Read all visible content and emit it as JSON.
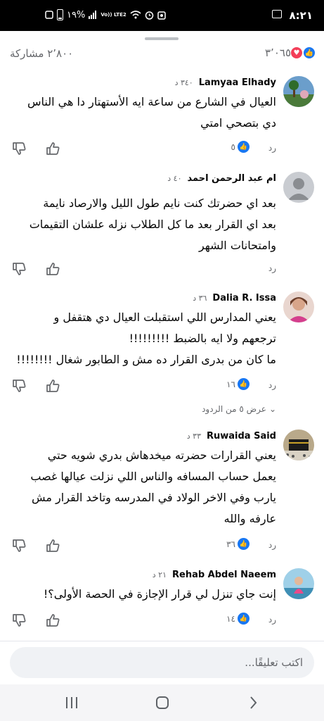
{
  "status_bar": {
    "time": "٨:٢١",
    "battery": "١٩%",
    "network": "Vo)) LTE2"
  },
  "summary": {
    "reaction_count": "٣٬٠٦٥",
    "shares": "٢٬٨٠٠ مشاركة",
    "reaction_types": [
      "like-icon",
      "love-icon"
    ]
  },
  "comments": [
    {
      "author": "Lamyaa Elhady",
      "age": "٣٤٠ د",
      "lines": [
        "العيال في الشارع من ساعة ايه الأستهتار دا هي الناس",
        "دي بتصحي امتي"
      ],
      "reply_label": "رد",
      "like_count": "٥"
    },
    {
      "author": "ام عبد الرحمن احمد",
      "age": "٤٠ د",
      "lines": [
        "بعد اي حضرتك كنت نايم طول الليل والارصاد نايمة",
        "بعد اي القرار بعد ما كل الطلاب نزله علشان التقيمات",
        "وامتحانات الشهر"
      ],
      "reply_label": "رد",
      "like_count": ""
    },
    {
      "author": "Dalia R. Issa",
      "age": "٣٦ د",
      "lines": [
        "يعني المدارس اللي استقبلت العيال دي هتقفل و",
        "ترجعهم ولا ايه بالضبط !!!!!!!!!",
        "ما كان من بدرى القرار ده مش و الطابور شغال !!!!!!!!"
      ],
      "reply_label": "رد",
      "like_count": "١٦"
    },
    {
      "author": "Ruwaida Said",
      "age": "٣٣ د",
      "lines": [
        "يعني القرارات حضرته ميخدهاش بدري شويه حتي",
        "يعمل حساب المسافه والناس اللي نزلت عيالها غصب",
        "يارب وفي الاخر الولاد في المدرسه وتاخد القرار مش",
        "عارفه والله"
      ],
      "reply_label": "رد",
      "like_count": "٣٦"
    },
    {
      "author": "Rehab Abdel Naeem",
      "age": "٢١ د",
      "lines": [
        "إنت جاي تنزل لي قرار الإجازة في الحصة الأولى؟!"
      ],
      "reply_label": "رد",
      "like_count": "١٤"
    }
  ],
  "view_replies": "عرض ٥ من الردود",
  "composer": {
    "placeholder": "اكتب تعليقًا..."
  },
  "colors": {
    "accent": "#1877f2",
    "love": "#f33e58",
    "muted": "#65676b"
  }
}
